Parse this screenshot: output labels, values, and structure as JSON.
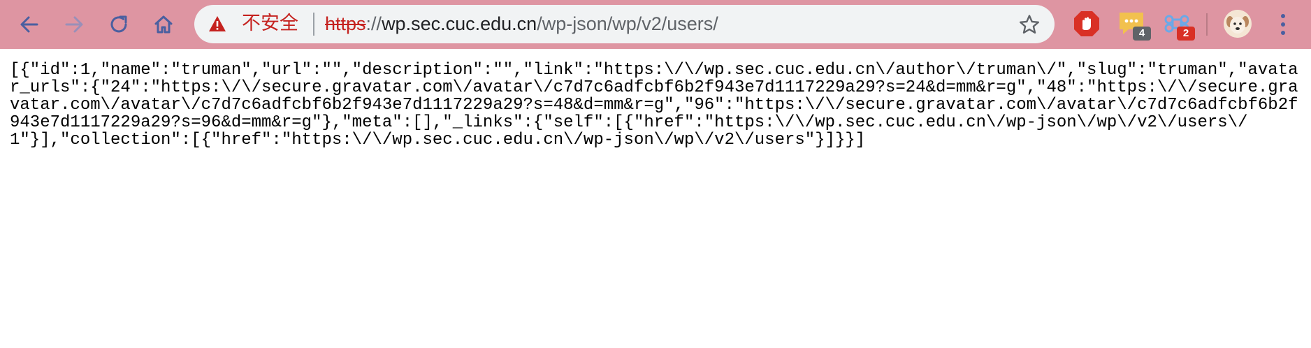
{
  "browser": {
    "nav": {
      "back_icon": "arrow-left-icon",
      "forward_icon": "arrow-right-icon",
      "reload_icon": "reload-icon",
      "home_icon": "home-icon"
    },
    "omnibox": {
      "security_icon": "warning-triangle-icon",
      "security_label": "不安全",
      "url_scheme": "https",
      "url_scheme_sep": "://",
      "url_host": "wp.sec.cuc.edu.cn",
      "url_path": "/wp-json/wp/v2/users/",
      "bookmark_icon": "star-icon"
    },
    "extensions": [
      {
        "name": "adblock-extension",
        "icon": "stop-hand-icon",
        "badge": ""
      },
      {
        "name": "chat-extension",
        "icon": "chat-bubble-icon",
        "badge": "4"
      },
      {
        "name": "shortcut-extension",
        "icon": "command-icon",
        "badge": "2"
      }
    ],
    "profile_icon": "avatar-icon",
    "menu_icon": "kebab-menu-icon"
  },
  "colors": {
    "toolbar": "#de95a2",
    "omnibox": "#f1f3f4",
    "insecure_red": "#c5221f",
    "icon_blue": "#4a5fa0"
  },
  "content": {
    "json_text": "[{\"id\":1,\"name\":\"truman\",\"url\":\"\",\"description\":\"\",\"link\":\"https:\\/\\/wp.sec.cuc.edu.cn\\/author\\/truman\\/\",\"slug\":\"truman\",\"avatar_urls\":{\"24\":\"https:\\/\\/secure.gravatar.com\\/avatar\\/c7d7c6adfcbf6b2f943e7d1117229a29?s=24&d=mm&r=g\",\"48\":\"https:\\/\\/secure.gravatar.com\\/avatar\\/c7d7c6adfcbf6b2f943e7d1117229a29?s=48&d=mm&r=g\",\"96\":\"https:\\/\\/secure.gravatar.com\\/avatar\\/c7d7c6adfcbf6b2f943e7d1117229a29?s=96&d=mm&r=g\"},\"meta\":[],\"_links\":{\"self\":[{\"href\":\"https:\\/\\/wp.sec.cuc.edu.cn\\/wp-json\\/wp\\/v2\\/users\\/1\"}],\"collection\":[{\"href\":\"https:\\/\\/wp.sec.cuc.edu.cn\\/wp-json\\/wp\\/v2\\/users\"}]}}]"
  }
}
